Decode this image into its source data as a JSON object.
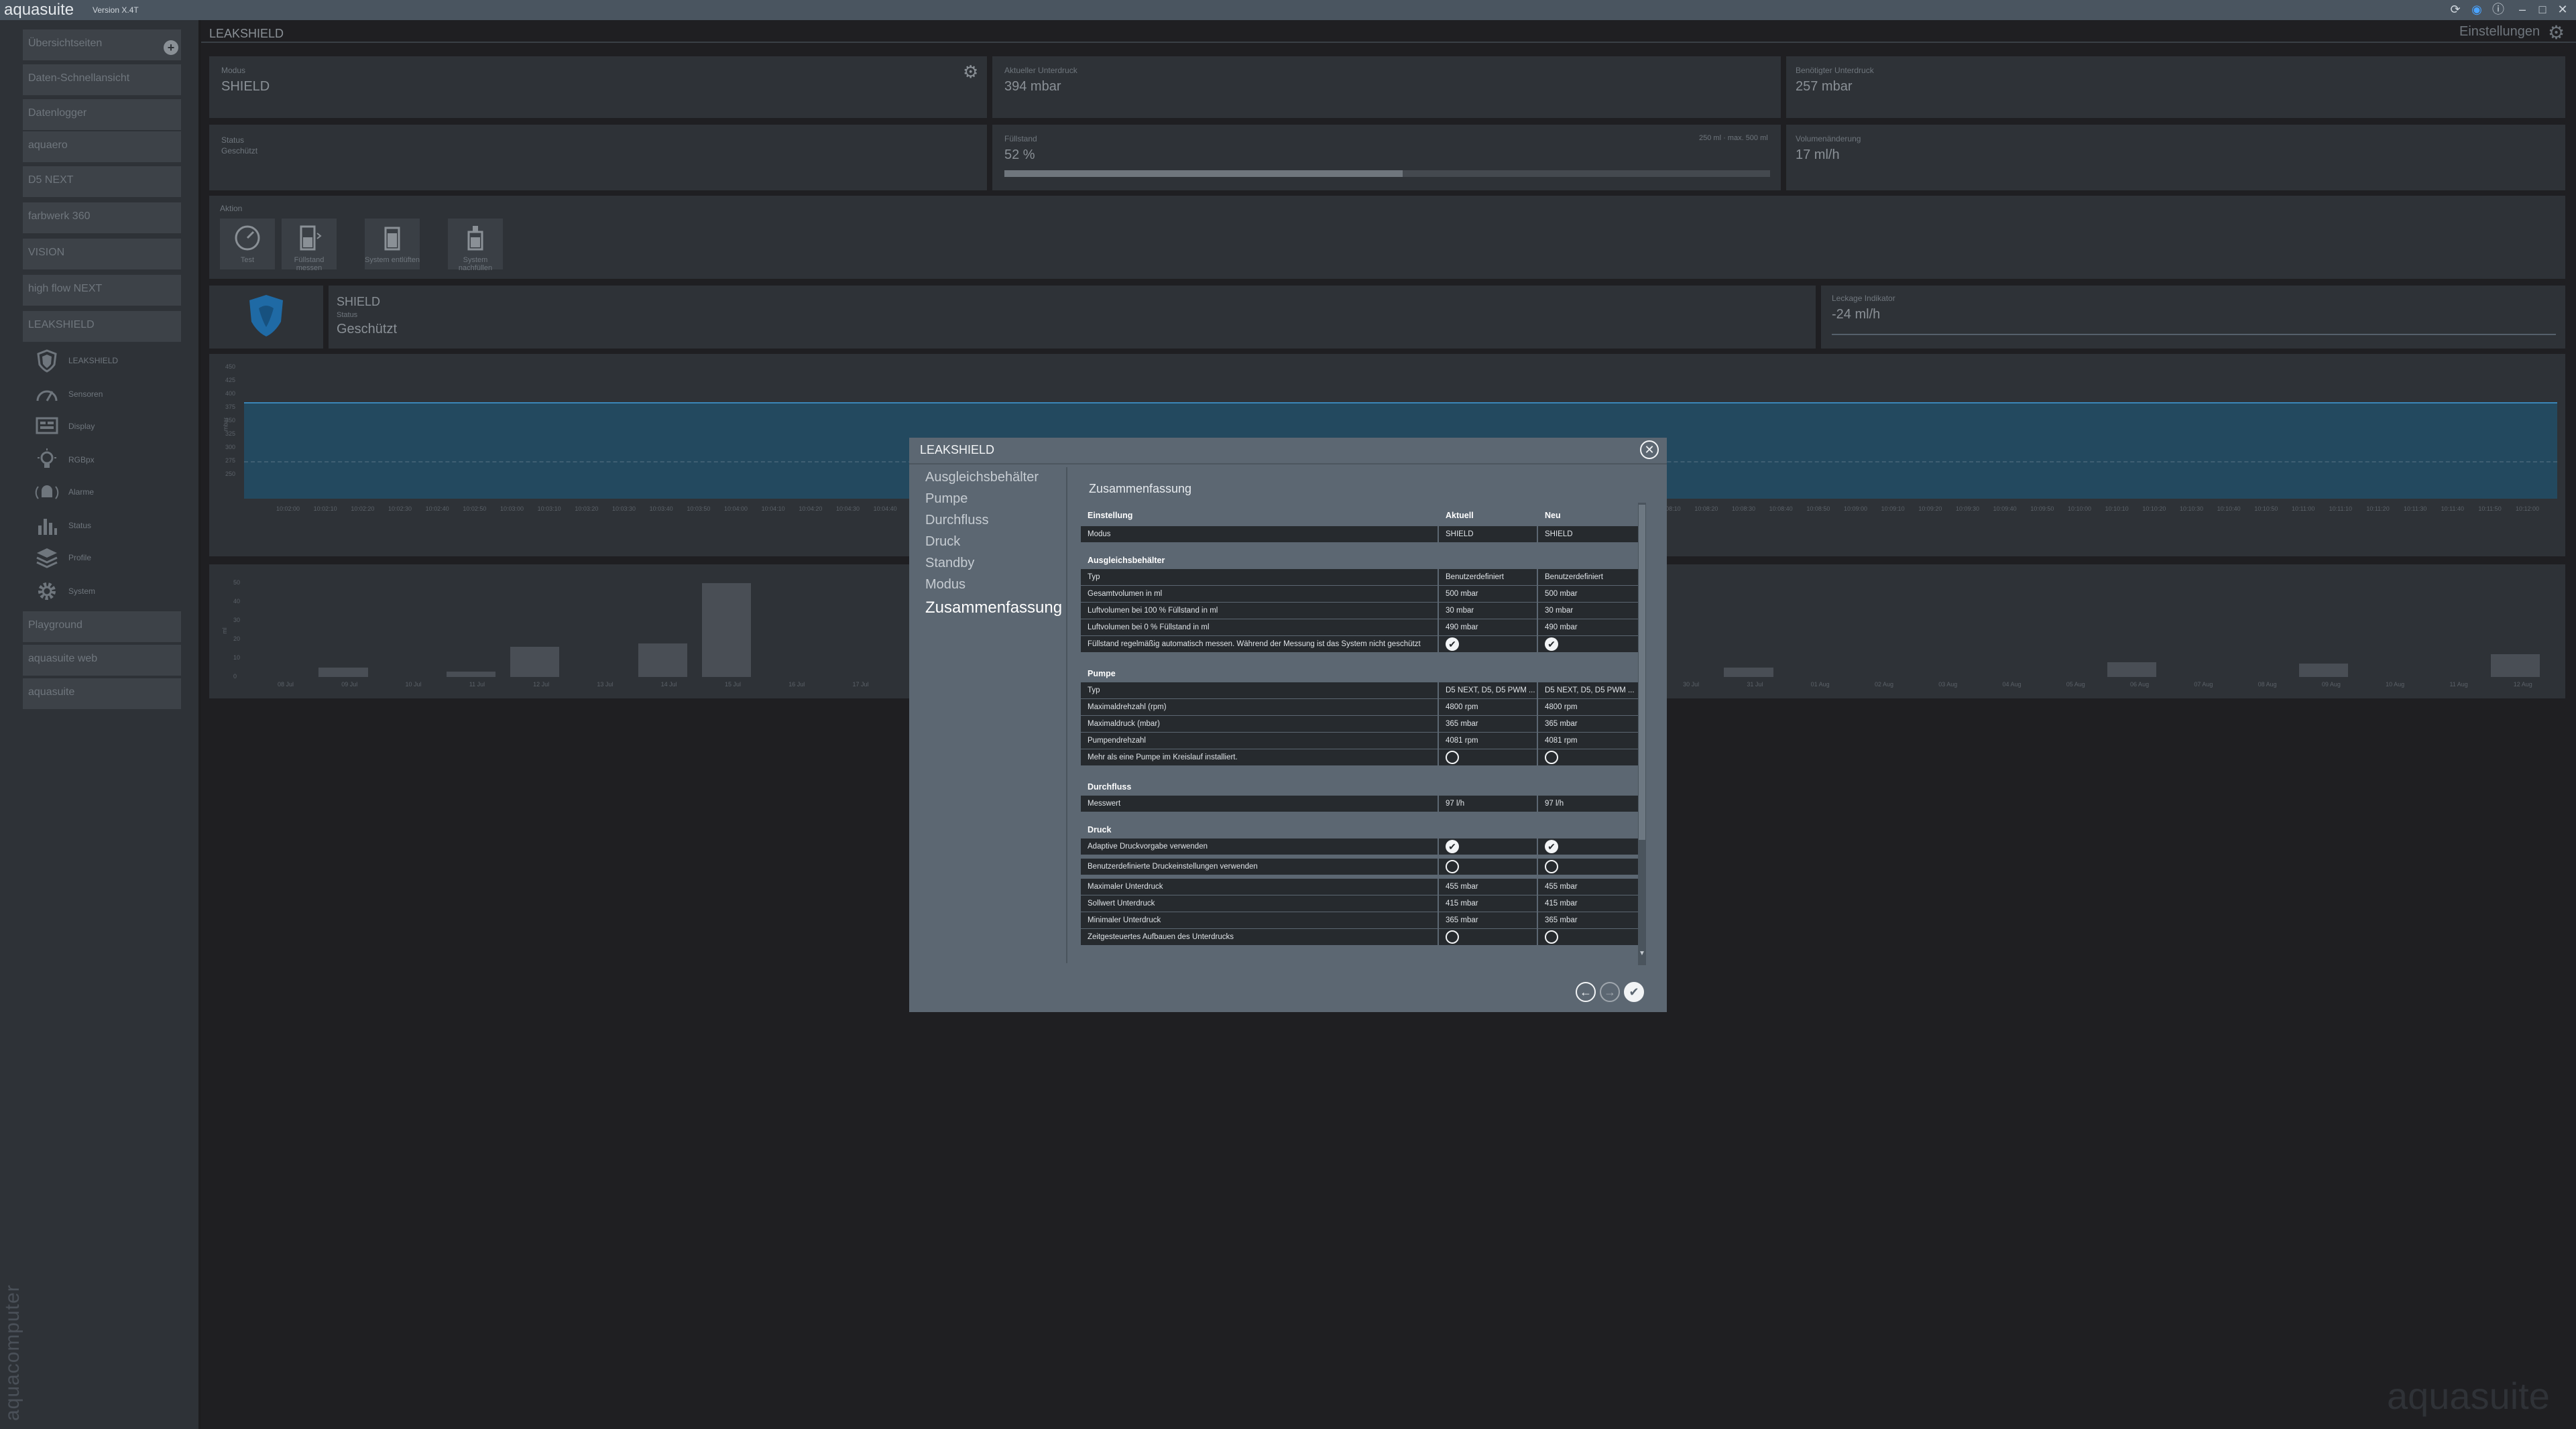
{
  "app": {
    "name": "aquasuite",
    "version": "Version X.4T"
  },
  "sidebar": {
    "overview": "Übersichtseiten",
    "items": [
      "Daten-Schnellansicht",
      "Datenlogger",
      "aquaero",
      "D5 NEXT",
      "farbwerk 360",
      "VISION",
      "high flow NEXT",
      "LEAKSHIELD"
    ],
    "sub_items": [
      {
        "label": "LEAKSHIELD",
        "icon": "shield-icon"
      },
      {
        "label": "Sensoren",
        "icon": "gauge-icon"
      },
      {
        "label": "Display",
        "icon": "display-icon"
      },
      {
        "label": "RGBpx",
        "icon": "bulb-icon"
      },
      {
        "label": "Alarme",
        "icon": "alarm-icon"
      },
      {
        "label": "Status",
        "icon": "chart-icon"
      },
      {
        "label": "Profile",
        "icon": "layers-icon"
      },
      {
        "label": "System",
        "icon": "gear-icon"
      }
    ],
    "bottom_items": [
      "Playground",
      "aquasuite web",
      "aquasuite"
    ],
    "brand": "aquacomputer"
  },
  "header": {
    "title": "LEAKSHIELD",
    "settings": "Einstellungen"
  },
  "panels": {
    "modus": {
      "label": "Modus",
      "value": "SHIELD"
    },
    "aktueller_unterdruck": {
      "label": "Aktueller Unterdruck",
      "value": "394 mbar"
    },
    "benoetigter_unterdruck": {
      "label": "Benötigter Unterdruck",
      "value": "257 mbar"
    },
    "status": {
      "label": "Status",
      "value": "Geschützt"
    },
    "fuellstand": {
      "label": "Füllstand",
      "value": "52 %",
      "extra": "250 ml · max. 500 ml",
      "level": 0.52
    },
    "volumenaenderung": {
      "label": "Volumenänderung",
      "value": "17 ml/h"
    },
    "aktion": {
      "label": "Aktion",
      "buttons": [
        {
          "label": "Test",
          "icon": "gauge-icon"
        },
        {
          "label": "Füllstand messen",
          "icon": "reservoir-icon"
        },
        {
          "label": "System entlüften",
          "icon": "vent-icon"
        },
        {
          "label": "System nachfüllen",
          "icon": "refill-icon"
        }
      ]
    },
    "shield": {
      "name": "SHIELD",
      "status_label": "Status",
      "status": "Geschützt"
    },
    "leckage": {
      "label": "Leckage Indikator",
      "value": "-24 ml/h"
    }
  },
  "chart1": {
    "y_ticks": [
      "450",
      "425",
      "400",
      "375",
      "350",
      "325",
      "300",
      "275",
      "250"
    ],
    "x_ticks": [
      "10:02:00",
      "10:02:10",
      "10:02:20",
      "10:02:30",
      "10:02:40",
      "10:02:50",
      "10:03:00",
      "10:03:10",
      "10:03:20",
      "10:03:30",
      "10:03:40",
      "10:03:50",
      "10:04:00",
      "10:04:10",
      "10:04:20",
      "10:04:30",
      "10:04:40",
      "10:04:50",
      "10:05:00",
      "10:05:10",
      "10:05:20",
      "10:05:30",
      "10:05:40",
      "10:05:50",
      "10:06:00",
      "10:06:10",
      "10:06:20",
      "10:06:30",
      "10:06:40",
      "10:06:50",
      "10:07:00",
      "10:07:10",
      "10:07:20",
      "10:07:30",
      "10:07:40",
      "10:07:50",
      "10:08:00",
      "10:08:10",
      "10:08:20",
      "10:08:30",
      "10:08:40",
      "10:08:50",
      "10:09:00",
      "10:09:10",
      "10:09:20",
      "10:09:30",
      "10:09:40",
      "10:09:50",
      "10:10:00",
      "10:10:10",
      "10:10:20",
      "10:10:30",
      "10:10:40",
      "10:10:50",
      "10:11:00",
      "10:11:10",
      "10:11:20",
      "10:11:30",
      "10:11:40",
      "10:11:50",
      "10:12:00"
    ]
  },
  "chart2": {
    "y_ticks": [
      "50",
      "40",
      "30",
      "20",
      "10",
      "0"
    ],
    "x_ticks": [
      "08 Jul",
      "09 Jul",
      "10 Jul",
      "11 Jul",
      "12 Jul",
      "13 Jul",
      "14 Jul",
      "15 Jul",
      "16 Jul",
      "17 Jul",
      "18 Jul",
      "19 Jul",
      "20 Jul",
      "21 Jul",
      "22 Jul",
      "23 Jul",
      "24 Jul",
      "25 Jul",
      "26 Jul",
      "27 Jul",
      "28 Jul",
      "29 Jul",
      "30 Jul",
      "31 Jul",
      "01 Aug",
      "02 Aug",
      "03 Aug",
      "04 Aug",
      "05 Aug",
      "06 Aug",
      "07 Aug",
      "08 Aug",
      "09 Aug",
      "10 Aug",
      "11 Aug",
      "12 Aug"
    ],
    "values": [
      0,
      5,
      0,
      3,
      16,
      0,
      18,
      50,
      0,
      0,
      0,
      0,
      0,
      0,
      0,
      0,
      0,
      0,
      0,
      0,
      0,
      0,
      0,
      5,
      0,
      0,
      0,
      0,
      0,
      8,
      0,
      0,
      7,
      0,
      0,
      12
    ]
  },
  "modal": {
    "title": "LEAKSHIELD",
    "nav": [
      "Ausgleichsbehälter",
      "Pumpe",
      "Durchfluss",
      "Druck",
      "Standby",
      "Modus",
      "Zusammenfassung"
    ],
    "summary_title": "Zusammenfassung",
    "headers": {
      "setting": "Einstellung",
      "current": "Aktuell",
      "new": "Neu"
    },
    "rows": [
      {
        "kind": "data",
        "label": "Modus",
        "current": "SHIELD",
        "new": "SHIELD"
      },
      {
        "kind": "section",
        "label": "Ausgleichsbehälter"
      },
      {
        "kind": "data",
        "label": "Typ",
        "current": "Benutzerdefiniert",
        "new": "Benutzerdefiniert"
      },
      {
        "kind": "data",
        "label": "Gesamtvolumen in ml",
        "current": "500 mbar",
        "new": "500 mbar"
      },
      {
        "kind": "data",
        "label": "Luftvolumen bei 100 % Füllstand in ml",
        "current": "30 mbar",
        "new": "30 mbar"
      },
      {
        "kind": "data",
        "label": "Luftvolumen bei 0 % Füllstand in ml",
        "current": "490 mbar",
        "new": "490 mbar"
      },
      {
        "kind": "check",
        "label": "Füllstand regelmäßig automatisch messen. Während der Messung ist das System nicht geschützt",
        "current": true,
        "new": true
      },
      {
        "kind": "section",
        "label": "Pumpe"
      },
      {
        "kind": "data",
        "label": "Typ",
        "current": "D5 NEXT, D5, D5 PWM ...",
        "new": "D5 NEXT, D5, D5 PWM ..."
      },
      {
        "kind": "data",
        "label": "Maximaldrehzahl (rpm)",
        "current": "4800 rpm",
        "new": "4800 rpm"
      },
      {
        "kind": "data",
        "label": "Maximaldruck (mbar)",
        "current": "365 mbar",
        "new": "365 mbar"
      },
      {
        "kind": "data",
        "label": "Pumpendrehzahl",
        "current": "4081 rpm",
        "new": "4081 rpm"
      },
      {
        "kind": "check",
        "label": "Mehr als eine Pumpe im Kreislauf installiert.",
        "current": false,
        "new": false
      },
      {
        "kind": "section",
        "label": "Durchfluss"
      },
      {
        "kind": "data",
        "label": "Messwert",
        "current": "97 l/h",
        "new": "97 l/h"
      },
      {
        "kind": "section",
        "label": "Druck"
      },
      {
        "kind": "check",
        "label": "Adaptive Druckvorgabe verwenden",
        "current": true,
        "new": true
      },
      {
        "kind": "check",
        "label": "Benutzerdefinierte Druckeinstellungen verwenden",
        "current": false,
        "new": false
      },
      {
        "kind": "data",
        "label": "Maximaler Unterdruck",
        "current": "455 mbar",
        "new": "455 mbar"
      },
      {
        "kind": "data",
        "label": "Sollwert Unterdruck",
        "current": "415 mbar",
        "new": "415 mbar"
      },
      {
        "kind": "data",
        "label": "Minimaler Unterdruck",
        "current": "365 mbar",
        "new": "365 mbar"
      },
      {
        "kind": "check",
        "label": "Zeitgesteuertes Aufbauen des Unterdrucks",
        "current": false,
        "new": false
      }
    ]
  }
}
